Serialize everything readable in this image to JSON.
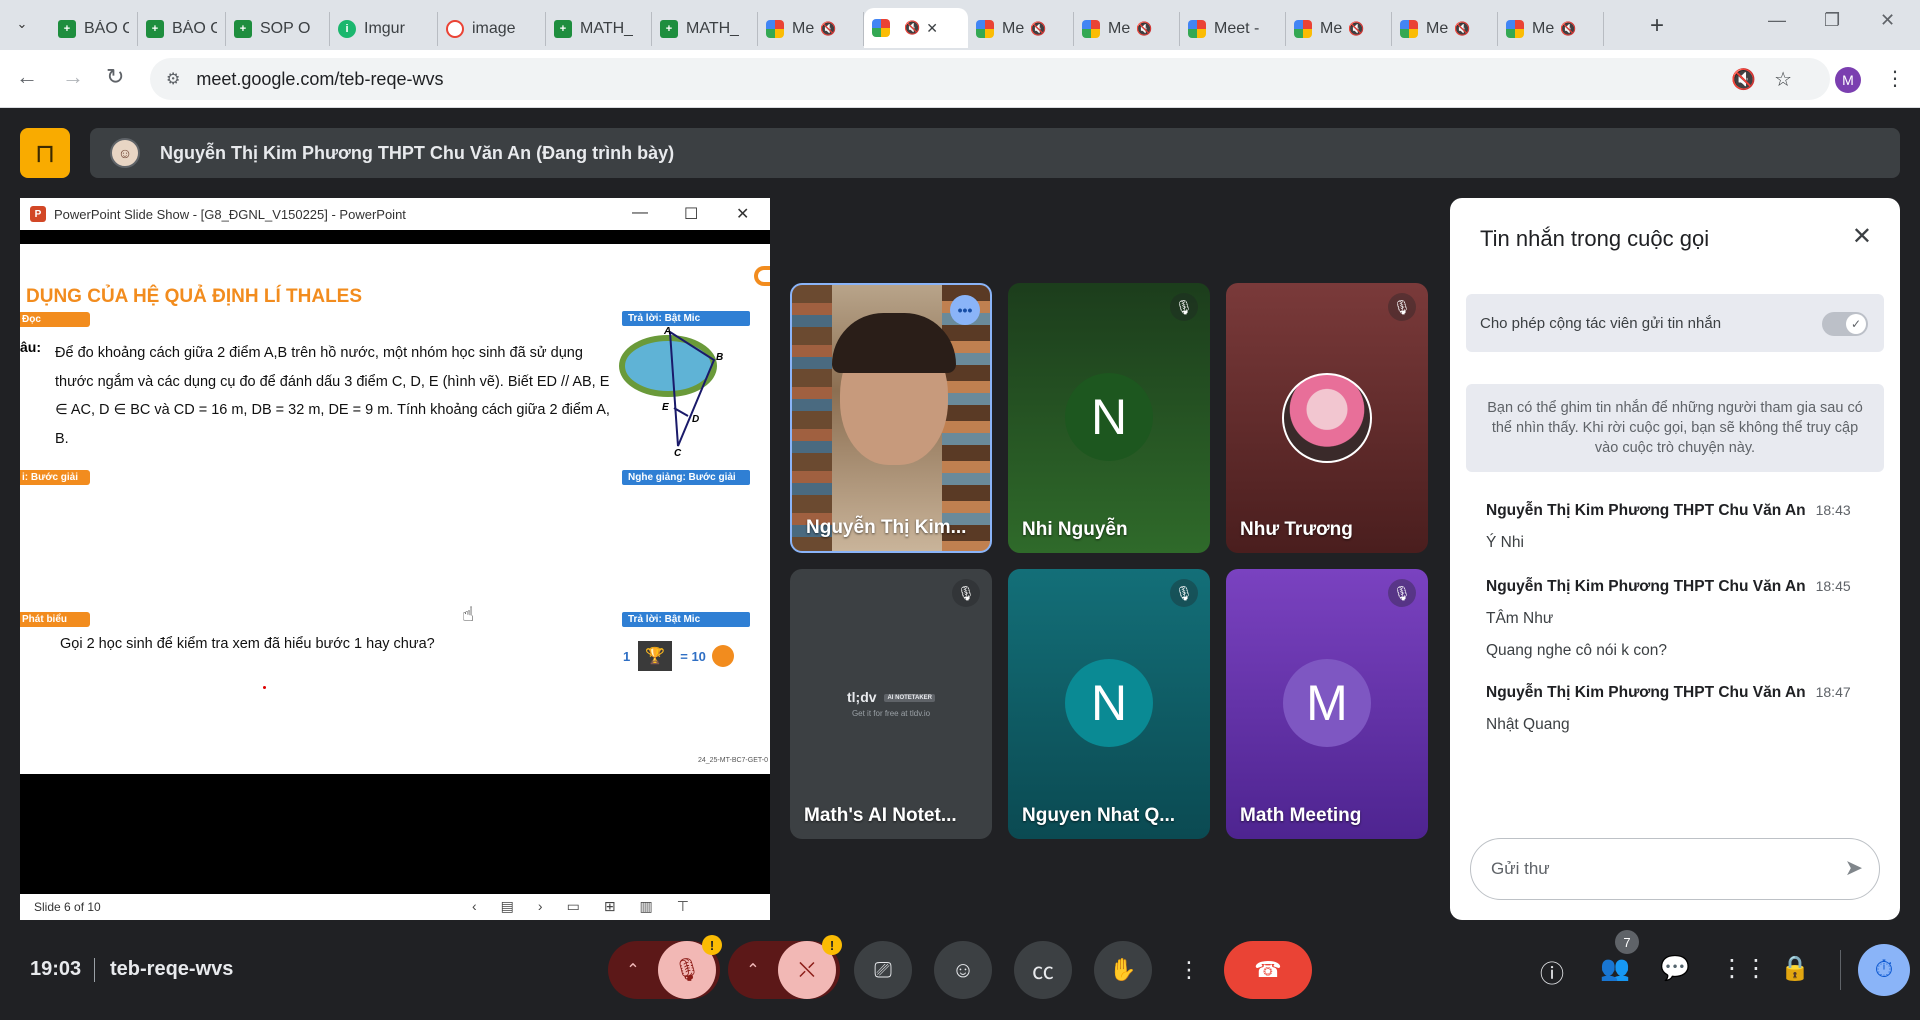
{
  "browser": {
    "tabs": [
      {
        "title": "BÁO C/",
        "icon": "sheets"
      },
      {
        "title": "BÁO C/",
        "icon": "sheets"
      },
      {
        "title": "SOP O",
        "icon": "sheets"
      },
      {
        "title": "Imgur",
        "icon": "imgur"
      },
      {
        "title": "image",
        "icon": "google-images"
      },
      {
        "title": "MATH_",
        "icon": "sheets"
      },
      {
        "title": "MATH_",
        "icon": "sheets"
      },
      {
        "title": "Me",
        "icon": "meet",
        "muted": true
      },
      {
        "title": "",
        "icon": "meet",
        "muted": true,
        "active": true
      },
      {
        "title": "Me",
        "icon": "meet",
        "muted": true
      },
      {
        "title": "Me",
        "icon": "meet",
        "muted": true
      },
      {
        "title": "Meet -",
        "icon": "meet"
      },
      {
        "title": "Me",
        "icon": "meet",
        "muted": true
      },
      {
        "title": "Me",
        "icon": "meet",
        "muted": true
      },
      {
        "title": "Me",
        "icon": "meet",
        "muted": true
      }
    ],
    "url": "meet.google.com/teb-reqe-wvs",
    "profile_initial": "M"
  },
  "presenter_bar": {
    "text": "Nguyễn Thị Kim Phương THPT Chu Văn An (Đang trình bày)"
  },
  "powerpoint": {
    "window_title": "PowerPoint Slide Show - [G8_ĐGNL_V150225] - PowerPoint",
    "slide_heading": "DỤNG CỦA HỆ QUẢ ĐỊNH LÍ THALES",
    "tag_doc": "Đọc",
    "question_label": "âu:",
    "question_text": "Để đo khoảng cách giữa 2 điểm A,B trên hồ nước, một nhóm học sinh đã sử dụng thước ngắm và các dụng cụ đo để đánh dấu 3 điểm C, D, E (hình vẽ). Biết ED // AB, E ∈ AC, D ∈ BC và CD = 16 m, DB = 32 m, DE = 9 m. Tính khoảng cách giữa 2 điểm A, B.",
    "tag_answer_mic_1": "Trả lời: Bật Mic",
    "tag_listen": "Nghe giảng: Bước giải",
    "tag_step": "i: Bước giải",
    "tag_speak": "Phát biểu",
    "tag_answer_mic_2": "Trả lời: Bật Mic",
    "call_line": "Gọi 2 học sinh để kiểm tra xem đã hiểu bước 1 hay chưa?",
    "reward_left": "1",
    "reward_right": "= 10",
    "slide_code": "24_25-MT-BC7-GET-0",
    "status": "Slide 6 of 10",
    "diagram_labels": {
      "a": "A",
      "b": "B",
      "c": "C",
      "d": "D",
      "e": "E"
    }
  },
  "tiles": [
    {
      "name": "Nguyễn Thị Kim...",
      "type": "video"
    },
    {
      "name": "Nhi Nguyễn",
      "initial": "N",
      "bg": "#1e5a1e",
      "muted": true
    },
    {
      "name": "Như Trương",
      "type": "photo",
      "bg": "#6a2a2a",
      "muted": true
    },
    {
      "name": "Math's AI Notet...",
      "type": "tldv",
      "bg": "#3c4043",
      "muted": true,
      "logo": "tl;dv",
      "logo_badge": "AI NOTETAKER",
      "logo_sub": "Get it for free at tldv.io"
    },
    {
      "name": "Nguyen Nhat Q...",
      "initial": "N",
      "bg": "#0f5f66",
      "muted": true
    },
    {
      "name": "Math Meeting",
      "initial": "M",
      "bg": "#5a2e9a",
      "muted": true
    }
  ],
  "chat": {
    "title": "Tin nhắn trong cuộc gọi",
    "allow_label": "Cho phép cộng tác viên gửi tin nhắn",
    "info": "Bạn có thể ghim tin nhắn để những người tham gia sau có thể nhìn thấy. Khi rời cuộc gọi, bạn sẽ không thể truy cập vào cuộc trò chuyện này.",
    "messages": [
      {
        "sender": "Nguyễn Thị Kim Phương THPT Chu Văn An",
        "time": "18:43",
        "lines": [
          "Ý Nhi"
        ]
      },
      {
        "sender": "Nguyễn Thị Kim Phương THPT Chu Văn An",
        "time": "18:45",
        "lines": [
          "TÂm Như",
          "Quang nghe cô nói k con?"
        ]
      },
      {
        "sender": "Nguyễn Thị Kim Phương THPT Chu Văn An",
        "time": "18:47",
        "lines": [
          "Nhật Quang"
        ]
      }
    ],
    "input_placeholder": "Gửi thư"
  },
  "bottom": {
    "time": "19:03",
    "meeting_code": "teb-reqe-wvs",
    "participants_count": "7",
    "warn_mark": "!"
  },
  "colors": {
    "meet_bg": "#202124",
    "accent_orange": "#f28c1e",
    "end_call_red": "#ea4335",
    "mic_off_pink": "#f2b8b5"
  }
}
